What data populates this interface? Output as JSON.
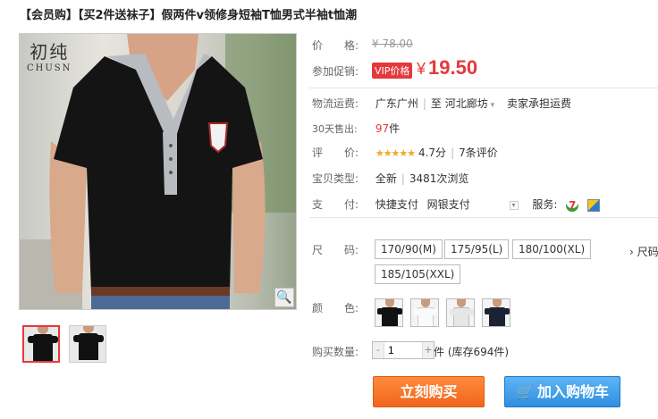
{
  "title": "【会员购】【买2件送袜子】假两件v领修身短袖T恤男式半袖t恤潮",
  "brand": {
    "cn": "初纯",
    "en": "CHUSN"
  },
  "price": {
    "label": "价　　格:",
    "original": "¥ 78.00",
    "promo_label": "参加促销:",
    "vip_tag": "VIP价格",
    "yen": "¥",
    "current": "19.50"
  },
  "shipping": {
    "label": "物流运费:",
    "from": "广东广州",
    "to_prefix": "至",
    "to": "河北廊坊",
    "note": "卖家承担运费"
  },
  "sales": {
    "label": "30天售出:",
    "count": "97",
    "unit": "件"
  },
  "rating": {
    "label": "评　　价:",
    "stars": "★★★★★",
    "score": "4.7分",
    "reviews": "7条评价"
  },
  "product_type": {
    "label": "宝贝类型:",
    "value": "全新",
    "views": "3481次浏览"
  },
  "payment": {
    "label": "支　　付:",
    "methods": [
      "快捷支付",
      "网银支付"
    ],
    "service_label": "服务:",
    "svc7": "7"
  },
  "size": {
    "label": "尺　　码:",
    "options": [
      "170/90(M)",
      "175/95(L)",
      "180/100(XL)",
      "185/105(XXL)"
    ],
    "more": "› 尺码"
  },
  "color": {
    "label": "颜　　色:",
    "swatches": [
      "#111111",
      "#f2f2f2",
      "#e8e8e8",
      "#1c2233"
    ]
  },
  "quantity": {
    "label": "购买数量:",
    "minus": "-",
    "value": "1",
    "plus": "+",
    "stock": "件 (库存694件)"
  },
  "actions": {
    "buy": "立刻购买",
    "cart_icon": "🛒",
    "cart": "加入购物车"
  },
  "zoom_icon": "🔍",
  "colors": {
    "accent": "#e4393c",
    "buy": "#f0661b",
    "cart": "#2e8fe0"
  }
}
